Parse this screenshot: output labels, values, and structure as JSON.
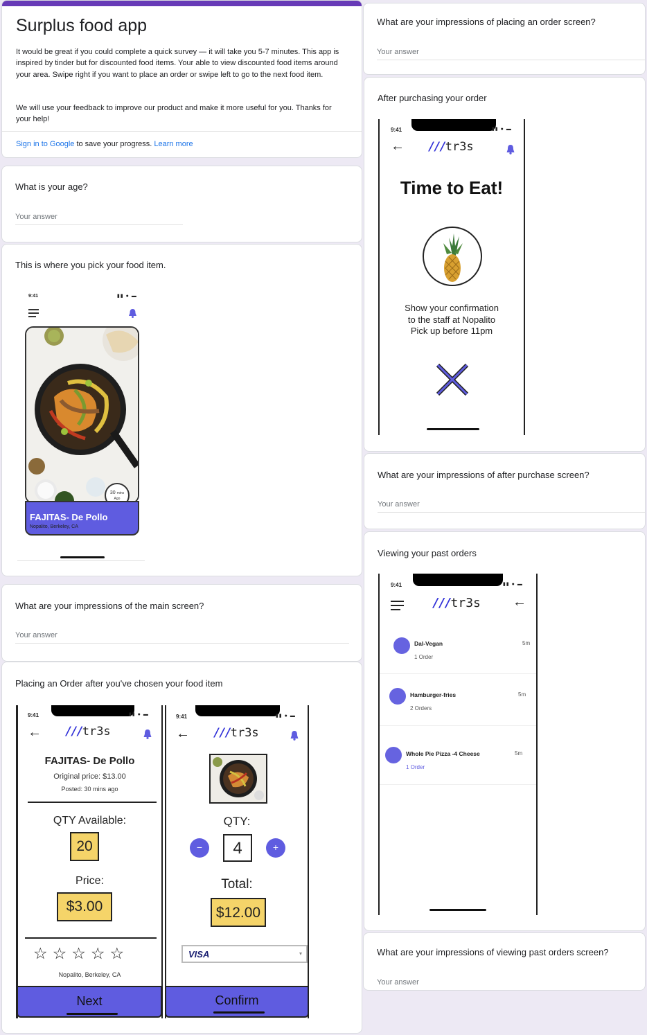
{
  "header": {
    "title": "Surplus food app",
    "description_1": "It would be great if you could complete a quick survey — it will take you 5-7 minutes. This app is inspired by tinder but for discounted food items. Your able to view discounted food items around your area. Swipe right if you want to place an order or swipe left to go to the next food item.",
    "description_2": "We will use your feedback to improve our product and make it more useful for you. Thanks for your help!",
    "sign_in": "Sign in to Google",
    "save_text": " to save your progress. ",
    "learn_more": "Learn more",
    "accent": "#673ab7"
  },
  "answer_placeholder": "Your answer",
  "questions": {
    "age": "What is your age?",
    "pick_food": "This is where you pick your food item.",
    "main_screen": "What are your impressions of the main screen?",
    "placing_order": "Placing an Order after you've chosen your food item",
    "placing_order_screen": "What are your impressions of placing an order screen?",
    "after_purchasing": "After purchasing your order",
    "after_purchase_screen": "What are your impressions of after purchase screen?",
    "viewing_past": "Viewing your past orders",
    "viewing_past_screen": "What are your impressions of viewing past orders screen?"
  },
  "phone_common": {
    "time": "9:41",
    "logo_slashes": "///",
    "logo_text": "tr3s",
    "brand_color": "#5f5ce0"
  },
  "main_screen": {
    "time_badge_line1": "30",
    "time_badge_line2": "mins",
    "time_badge_line3": "Ago",
    "item_name": "FAJITAS- De Pollo",
    "item_location": "Nopalito, Berkeley, CA"
  },
  "order_detail": {
    "item_name": "FAJITAS- De Pollo",
    "original_price": "Original price: $13.00",
    "posted": "Posted: 30 mins ago",
    "qty_label": "QTY Available:",
    "qty_value": "20",
    "price_label": "Price:",
    "price_value": "$3.00",
    "rating_stars": 5,
    "location": "Nopalito, Berkeley, CA",
    "next_button": "Next"
  },
  "order_confirm": {
    "qty_label": "QTY:",
    "qty_value": "4",
    "minus": "−",
    "plus": "+",
    "total_label": "Total:",
    "total_value": "$12.00",
    "payment": "VISA",
    "confirm_button": "Confirm"
  },
  "after_purchase": {
    "headline": "Time to Eat!",
    "line1": "Show your confirmation",
    "line2": "to the staff at Nopalito",
    "line3": "Pick up before 11pm"
  },
  "past_orders": {
    "orders": [
      {
        "name": "Dal-Vegan",
        "count": "1 Order",
        "time": "5m"
      },
      {
        "name": "Hamburger-fries",
        "count": "2 Orders",
        "time": "5m"
      },
      {
        "name": "Whole Pie Pizza -4 Cheese",
        "count": "1 Order",
        "time": "5m"
      }
    ]
  }
}
